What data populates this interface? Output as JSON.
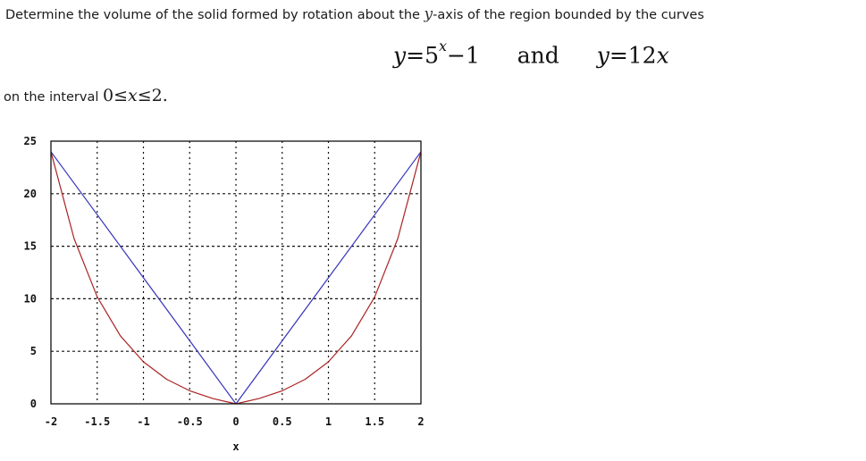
{
  "problem": {
    "intro_before_var": "Determine the volume of the solid formed by rotation about the",
    "axis_variable": "y",
    "intro_after_var": "-axis of the region bounded by the curves",
    "equation": {
      "curve1_lhs": "y",
      "curve1_eq": "=5",
      "curve1_exp": "x",
      "curve1_tail": "−1",
      "connector": "and",
      "curve2_lhs": "y",
      "curve2_eq": "=12",
      "curve2_var": "x"
    },
    "interval_prefix": "on the interval",
    "interval_low": "0",
    "interval_le1": "≤",
    "interval_var": "x",
    "interval_le2": "≤",
    "interval_high": "2."
  },
  "chart_data": {
    "type": "line",
    "title": "",
    "xlabel": "x",
    "ylabel": "",
    "xlim": [
      -2,
      2
    ],
    "ylim": [
      0,
      25
    ],
    "grid": true,
    "x_ticks": [
      -2,
      -1.5,
      -1,
      -0.5,
      0,
      0.5,
      1,
      1.5,
      2
    ],
    "x_tick_labels": [
      "-2",
      "-1.5",
      "-1",
      "-0.5",
      "0",
      "0.5",
      "1",
      "1.5",
      "2"
    ],
    "y_ticks": [
      0,
      5,
      10,
      15,
      20,
      25
    ],
    "y_tick_labels": [
      "0",
      "5",
      "10",
      "15",
      "20",
      "25"
    ],
    "legend": "none",
    "series": [
      {
        "name": "y = 12|x|",
        "color": "#3333bb",
        "x": [
          -2,
          -1.5,
          -1,
          -0.5,
          0,
          0.5,
          1,
          1.5,
          2
        ],
        "y": [
          24,
          18,
          12,
          6,
          0,
          6,
          12,
          18,
          24
        ]
      },
      {
        "name": "y = 5^|x| - 1",
        "color": "#aa2222",
        "x": [
          -2,
          -1.75,
          -1.5,
          -1.25,
          -1,
          -0.75,
          -0.5,
          -0.25,
          0,
          0.25,
          0.5,
          0.75,
          1,
          1.25,
          1.5,
          1.75,
          2
        ],
        "y": [
          24,
          15.72,
          10.18,
          6.48,
          4,
          2.34,
          1.24,
          0.5,
          0,
          0.5,
          1.24,
          2.34,
          4,
          6.48,
          10.18,
          15.72,
          24
        ]
      }
    ]
  }
}
